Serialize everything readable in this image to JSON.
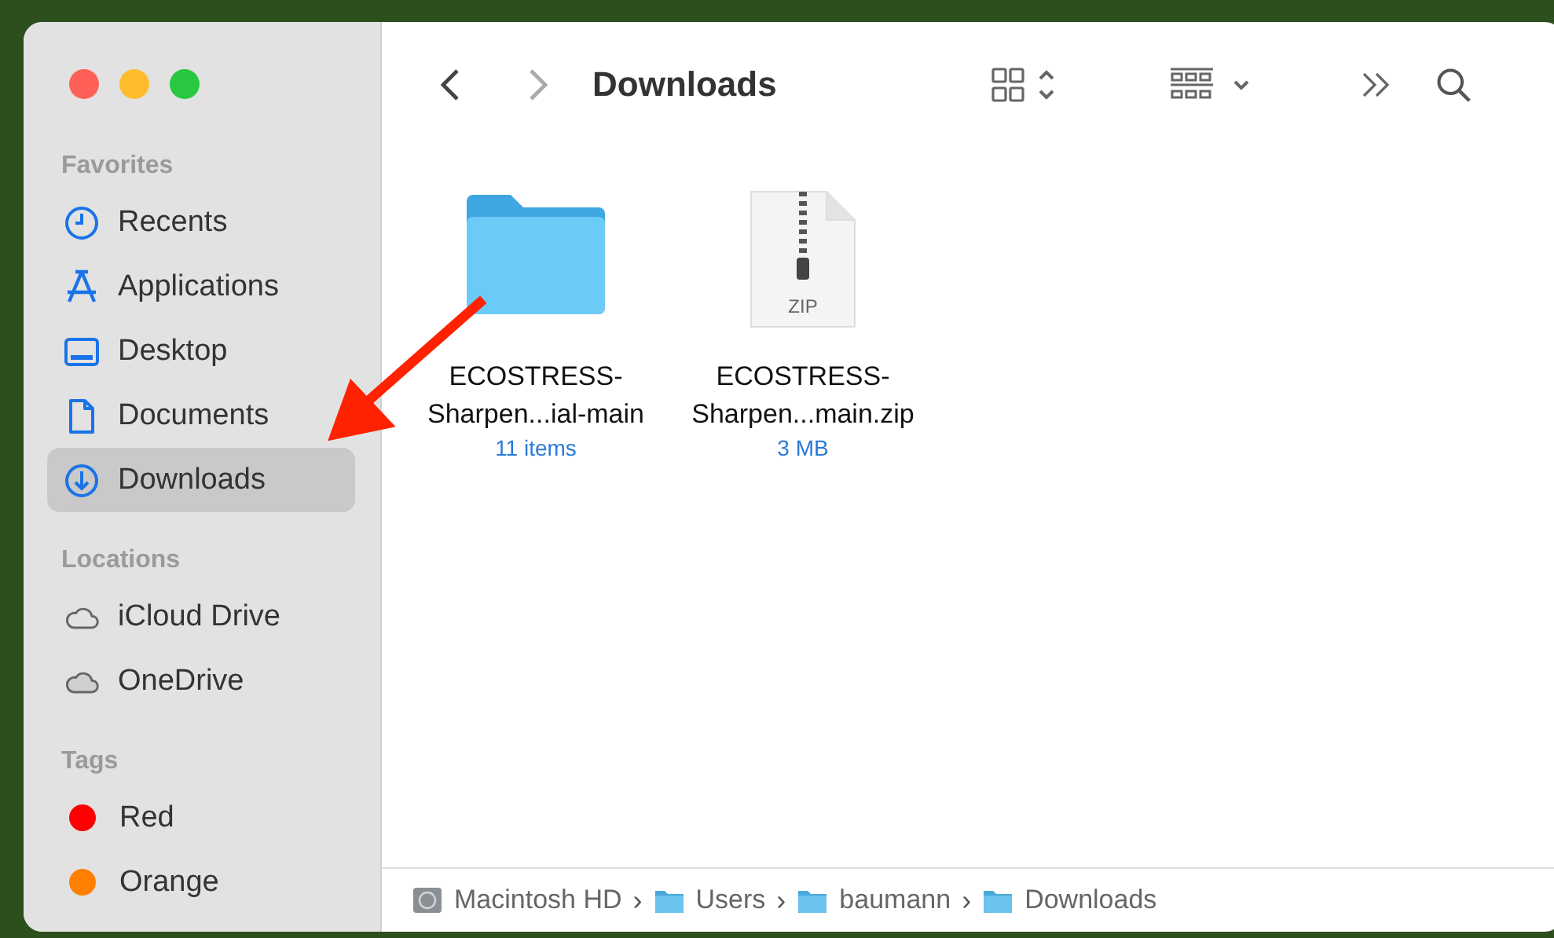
{
  "window": {
    "title": "Downloads"
  },
  "sidebar": {
    "sections": [
      {
        "title": "Favorites",
        "items": [
          {
            "label": "Recents",
            "kind": "clock",
            "selected": false
          },
          {
            "label": "Applications",
            "kind": "apps",
            "selected": false
          },
          {
            "label": "Desktop",
            "kind": "desktop",
            "selected": false
          },
          {
            "label": "Documents",
            "kind": "document",
            "selected": false
          },
          {
            "label": "Downloads",
            "kind": "download",
            "selected": true
          }
        ]
      },
      {
        "title": "Locations",
        "items": [
          {
            "label": "iCloud Drive",
            "kind": "cloud",
            "selected": false
          },
          {
            "label": "OneDrive",
            "kind": "cloud-filled",
            "selected": false
          }
        ]
      },
      {
        "title": "Tags",
        "items": [
          {
            "label": "Red",
            "kind": "tag",
            "color": "#ff0000",
            "selected": false
          },
          {
            "label": "Orange",
            "kind": "tag",
            "color": "#ff8000",
            "selected": false
          }
        ]
      }
    ]
  },
  "files": [
    {
      "kind": "folder",
      "name": [
        "ECOSTRESS-",
        "Sharpen...ial-main"
      ],
      "info": "11 items"
    },
    {
      "kind": "zip",
      "badge": "ZIP",
      "name": [
        "ECOSTRESS-",
        "Sharpen...main.zip"
      ],
      "info": "3 MB"
    }
  ],
  "path_bar": [
    {
      "label": "Macintosh HD",
      "kind": "disk"
    },
    {
      "label": "Users",
      "kind": "folder"
    },
    {
      "label": "baumann",
      "kind": "folder"
    },
    {
      "label": "Downloads",
      "kind": "folder"
    }
  ],
  "separator": "›"
}
